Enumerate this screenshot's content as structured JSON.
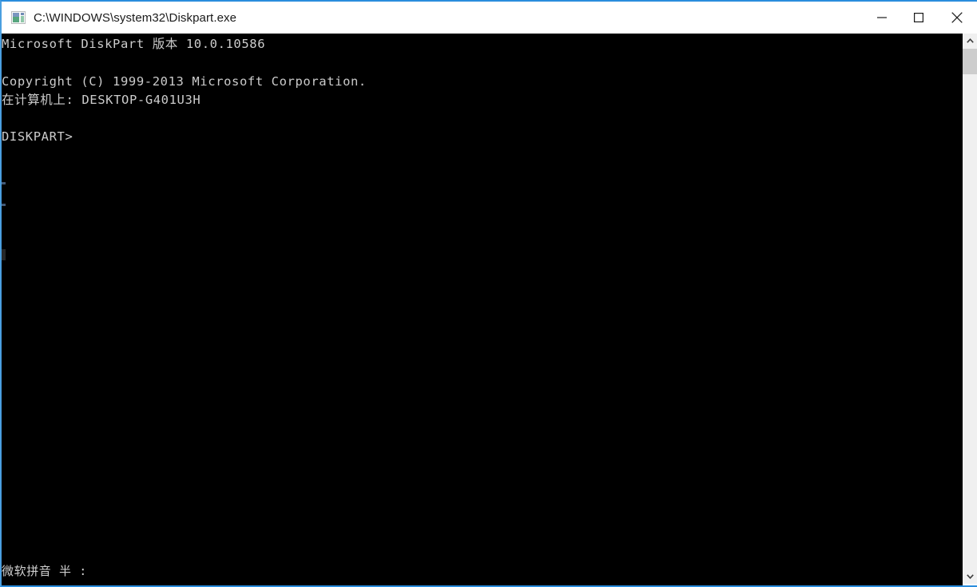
{
  "window": {
    "title": "C:\\WINDOWS\\system32\\Diskpart.exe",
    "icon": "console-app-icon",
    "accent_border_color": "#2a8ddd",
    "titlebar_background": "#ffffff",
    "titlebar_text_color": "#1a1a1a",
    "controls": {
      "minimize_label": "Minimize",
      "maximize_label": "Maximize",
      "close_label": "Close"
    }
  },
  "console": {
    "background_color": "#000000",
    "text_color": "#cccccc",
    "lines": [
      "Microsoft DiskPart 版本 10.0.10586",
      "",
      "Copyright (C) 1999-2013 Microsoft Corporation.",
      "在计算机上: DESKTOP-G401U3H",
      "",
      "DISKPART>"
    ],
    "text_block": "Microsoft DiskPart 版本 10.0.10586\n\nCopyright (C) 1999-2013 Microsoft Corporation.\n在计算机上: DESKTOP-G401U3H\n\nDISKPART>",
    "prompt": "DISKPART>",
    "product_name": "Microsoft DiskPart",
    "version_label": "版本",
    "version": "10.0.10586",
    "copyright": "Copyright (C) 1999-2013 Microsoft Corporation.",
    "host_label": "在计算机上:",
    "host_name": "DESKTOP-G401U3H"
  },
  "ime": {
    "status_text": "微软拼音 半 :",
    "method_name": "微软拼音",
    "width_mode": "半",
    "punctuation_mode": ":"
  },
  "scrollbar": {
    "orientation": "vertical",
    "up_arrow": "▲",
    "down_arrow": "▼",
    "track_color": "#f0f0f0",
    "thumb_color": "#cdcdcd"
  }
}
